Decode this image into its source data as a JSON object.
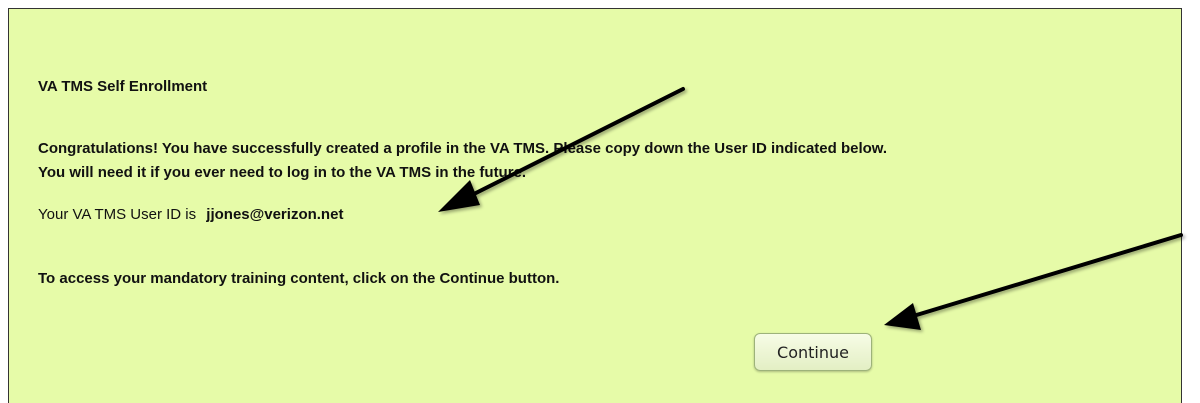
{
  "panel": {
    "title": "VA TMS Self Enrollment",
    "congrats_line1": "Congratulations! You have successfully created a profile in the VA TMS. Please copy down the User ID indicated below.",
    "congrats_line2": "You will need it if you ever need to log in to the VA TMS in the future.",
    "userid_label": "Your VA TMS User ID is",
    "userid_value": "jjones@verizon.net",
    "access_text": "To access your mandatory training content, click on the Continue button.",
    "continue_label": "Continue"
  },
  "colors": {
    "panel_background": "#e6fba8",
    "text": "#111111",
    "arrow": "#000000"
  },
  "annotations": [
    {
      "icon": "arrow-icon",
      "points_to": "user-id-value"
    },
    {
      "icon": "arrow-icon",
      "points_to": "continue-button"
    }
  ]
}
